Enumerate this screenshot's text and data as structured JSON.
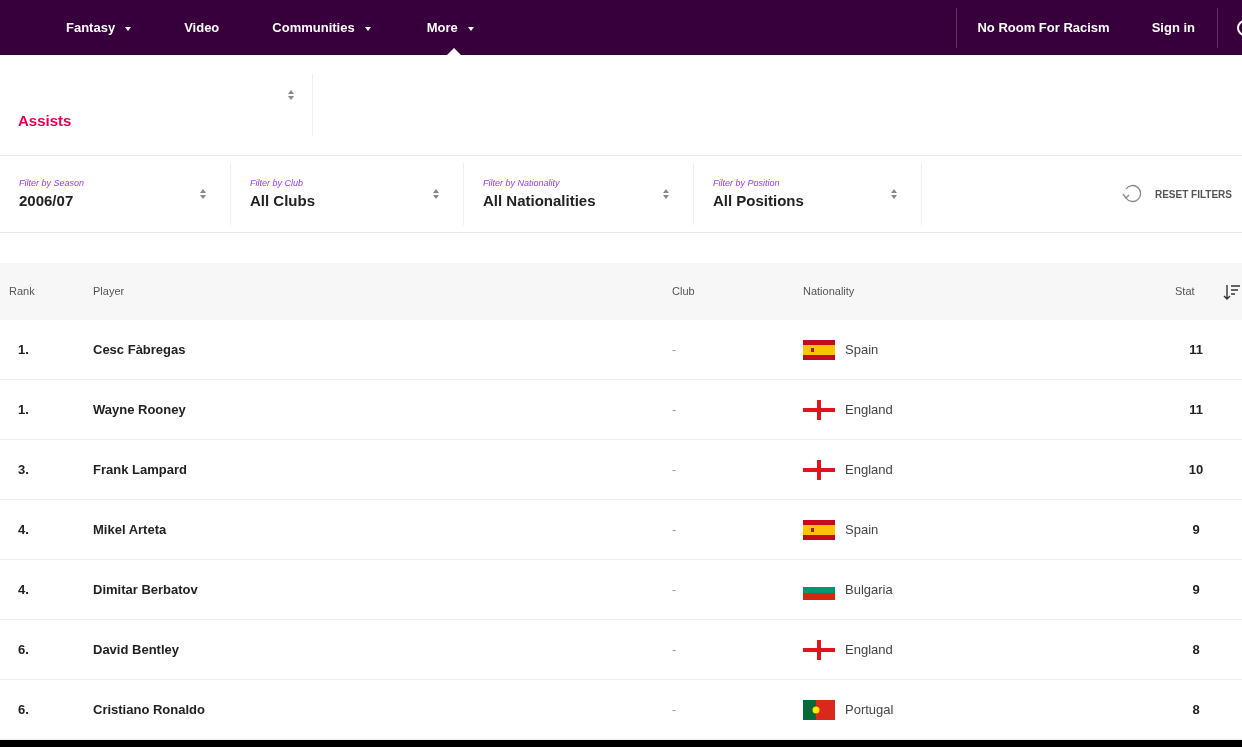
{
  "nav": {
    "items": [
      {
        "label": "Fantasy",
        "dropdown": true,
        "selected": false
      },
      {
        "label": "Video",
        "dropdown": false,
        "selected": false
      },
      {
        "label": "Communities",
        "dropdown": true,
        "selected": false
      },
      {
        "label": "More",
        "dropdown": true,
        "selected": true
      }
    ],
    "right_links": [
      "No Room For Racism",
      "Sign in"
    ]
  },
  "stat_select": {
    "value": "Assists"
  },
  "filters": [
    {
      "label": "Filter by Season",
      "value": "2006/07"
    },
    {
      "label": "Filter by Club",
      "value": "All Clubs"
    },
    {
      "label": "Filter by Nationality",
      "value": "All Nationalities"
    },
    {
      "label": "Filter by Position",
      "value": "All Positions"
    }
  ],
  "reset_button": "RESET FILTERS",
  "table": {
    "columns": [
      "Rank",
      "Player",
      "Club",
      "Nationality",
      "Stat"
    ],
    "rows": [
      {
        "rank": "1.",
        "player": "Cesc Fàbregas",
        "club": "-",
        "nationality": "Spain",
        "kind": "spain",
        "stat": "11"
      },
      {
        "rank": "1.",
        "player": "Wayne Rooney",
        "club": "-",
        "nationality": "England",
        "kind": "england",
        "stat": "11"
      },
      {
        "rank": "3.",
        "player": "Frank Lampard",
        "club": "-",
        "nationality": "England",
        "kind": "england",
        "stat": "10"
      },
      {
        "rank": "4.",
        "player": "Mikel Arteta",
        "club": "-",
        "nationality": "Spain",
        "kind": "spain",
        "stat": "9"
      },
      {
        "rank": "4.",
        "player": "Dimitar Berbatov",
        "club": "-",
        "nationality": "Bulgaria",
        "kind": "bulgaria",
        "stat": "9"
      },
      {
        "rank": "6.",
        "player": "David Bentley",
        "club": "-",
        "nationality": "England",
        "kind": "england",
        "stat": "8"
      },
      {
        "rank": "6.",
        "player": "Cristiano Ronaldo",
        "club": "-",
        "nationality": "Portugal",
        "kind": "portugal",
        "stat": "8"
      }
    ]
  }
}
